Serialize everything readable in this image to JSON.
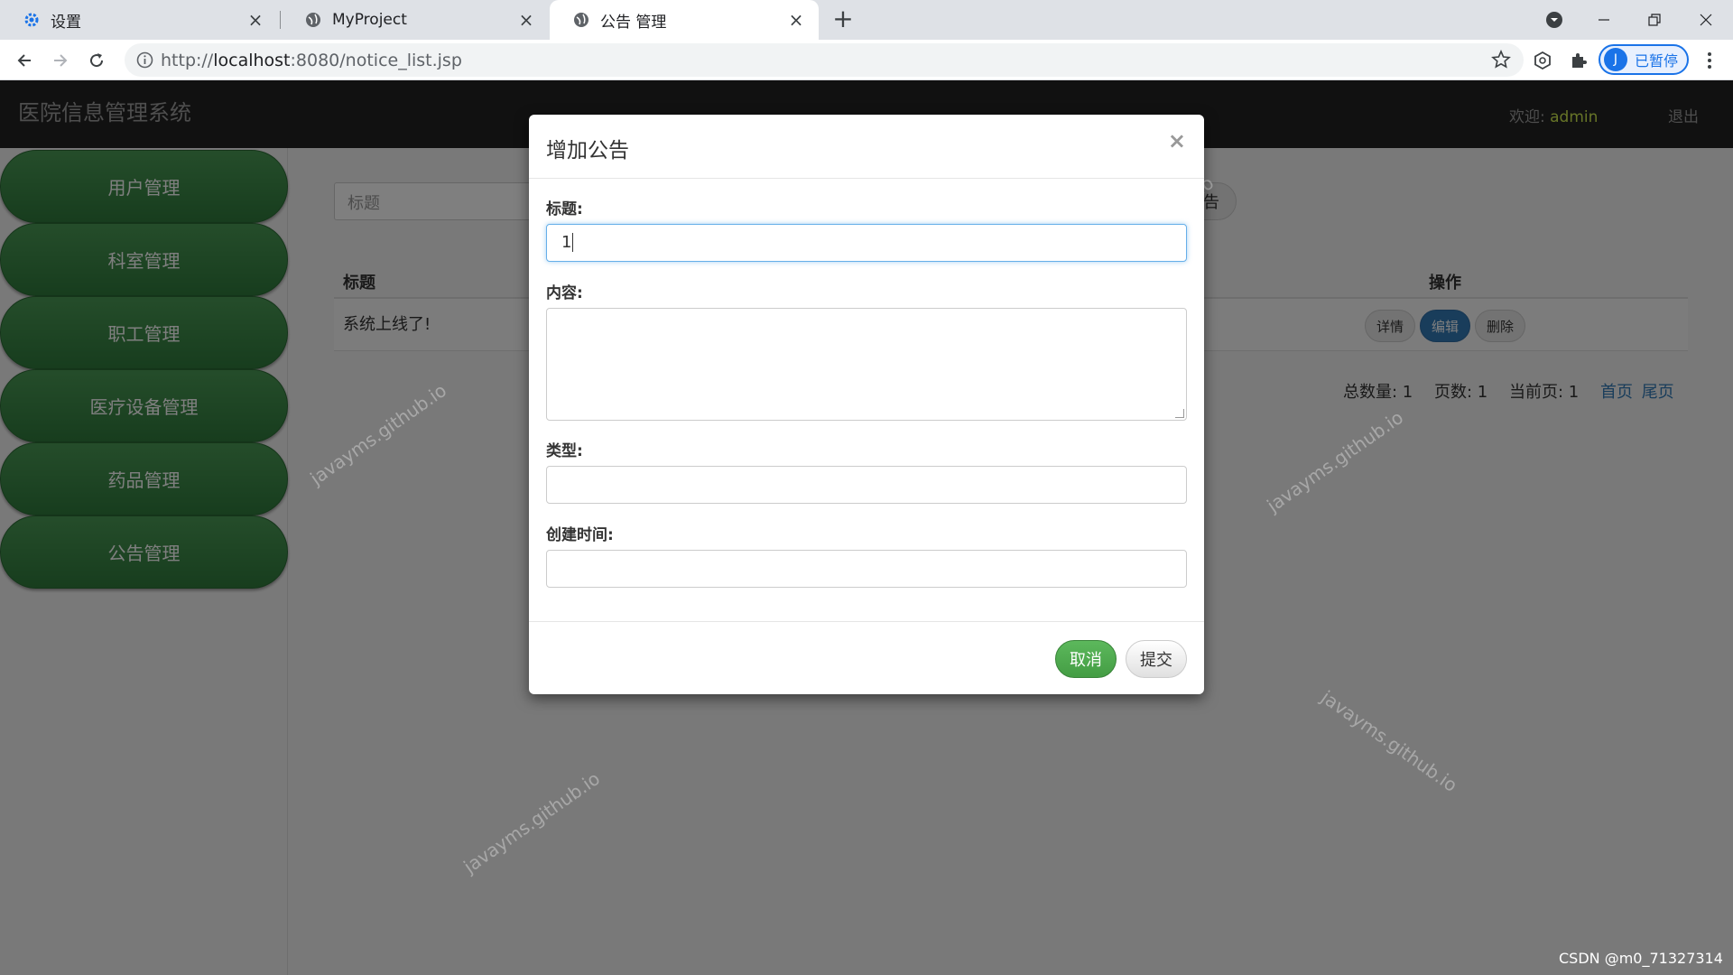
{
  "browser": {
    "tabs": [
      {
        "label": "设置"
      },
      {
        "label": "MyProject"
      },
      {
        "label": "公告 管理"
      }
    ],
    "url_prefix": "http://",
    "url_host": "localhost",
    "url_path": ":8080/notice_list.jsp",
    "profile_initial": "J",
    "profile_label": "已暂停",
    "accent": "#1a73e8"
  },
  "app": {
    "brand": "医院信息管理系统",
    "welcome_label": "欢迎:",
    "username": "admin",
    "logout": "退出"
  },
  "sidebar": {
    "items": [
      {
        "label": "用户管理"
      },
      {
        "label": "科室管理"
      },
      {
        "label": "职工管理"
      },
      {
        "label": "医疗设备管理"
      },
      {
        "label": "药品管理"
      },
      {
        "label": "公告管理"
      }
    ],
    "button_color": "#2f7a3c"
  },
  "main": {
    "search_placeholder": "标题",
    "add_button_fragment": "告",
    "table": {
      "col_title": "标题",
      "col_actions": "操作",
      "rows": [
        {
          "title": "系统上线了!"
        }
      ],
      "actions": {
        "detail": "详情",
        "edit": "编辑",
        "delete": "删除"
      }
    },
    "pager": {
      "total": "总数量: 1",
      "pages": "页数: 1",
      "current": "当前页: 1",
      "first": "首页",
      "last": "尾页"
    }
  },
  "modal": {
    "title": "增加公告",
    "close": "×",
    "fields": {
      "title_label": "标题:",
      "title_value": "1",
      "content_label": "内容:",
      "type_label": "类型:",
      "created_label": "创建时间:"
    },
    "cancel": "取消",
    "submit": "提交"
  },
  "watermark": "javayms.github.io",
  "footer_mark": "CSDN @m0_71327314"
}
